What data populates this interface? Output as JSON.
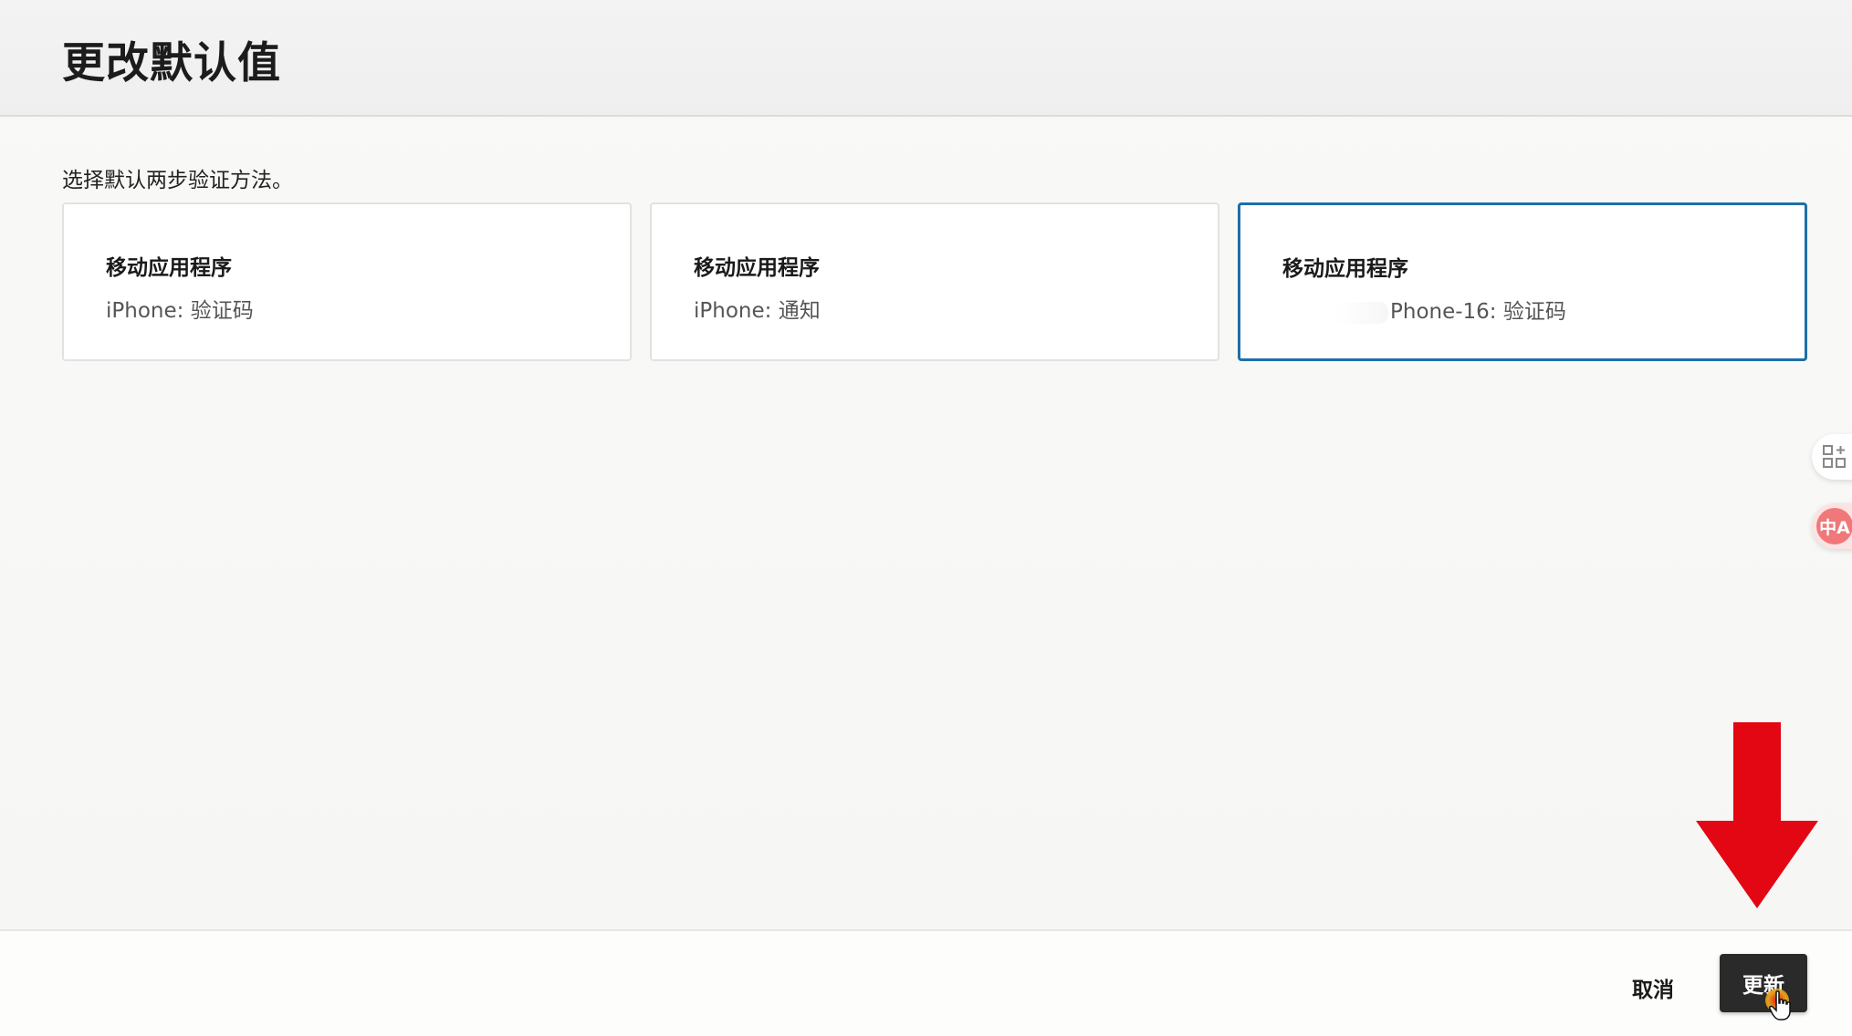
{
  "header": {
    "title": "更改默认值"
  },
  "main": {
    "instruction": "选择默认两步验证方法。",
    "options": [
      {
        "title": "移动应用程序",
        "detail": "iPhone: 验证码",
        "selected": false
      },
      {
        "title": "移动应用程序",
        "detail": "iPhone: 通知",
        "selected": false
      },
      {
        "title": "移动应用程序",
        "detail": "Phone-16: 验证码",
        "selected": true
      }
    ]
  },
  "side_tools": {
    "apps_icon": "apps-grid-plus-icon",
    "translate_icon": "translate-icon",
    "translate_label": "中A"
  },
  "footer": {
    "cancel_label": "取消",
    "update_label": "更新"
  },
  "annotation": {
    "arrow_icon": "down-arrow-icon",
    "arrow_color": "#e30613"
  },
  "colors": {
    "selected_border": "#1e6fa8",
    "primary_button_bg": "#2a2a2a"
  }
}
